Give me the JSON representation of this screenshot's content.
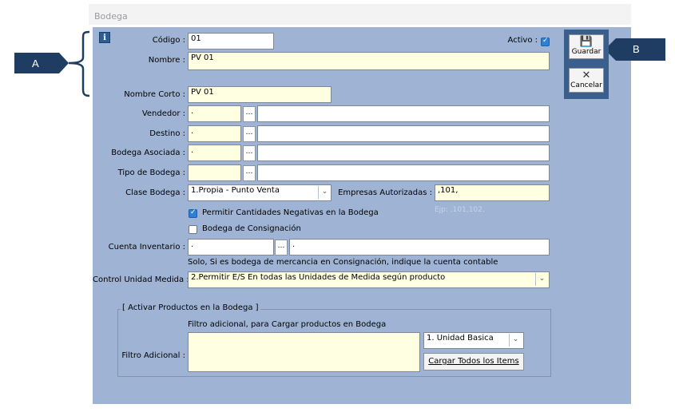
{
  "window": {
    "title": "Bodega"
  },
  "callouts": {
    "a": "A",
    "b": "B"
  },
  "toolbar": {
    "save_label": "Guardar",
    "cancel_label": "Cancelar"
  },
  "form": {
    "codigo": {
      "label": "Código :",
      "value": "01"
    },
    "activo": {
      "label": "Activo :",
      "checked": true
    },
    "nombre": {
      "label": "Nombre :",
      "value": "PV 01"
    },
    "nombre_corto": {
      "label": "Nombre Corto :",
      "value": "PV 01"
    },
    "vendedor": {
      "label": "Vendedor :",
      "code": ".",
      "desc": ""
    },
    "destino": {
      "label": "Destino :",
      "code": ".",
      "desc": ""
    },
    "bodega_asociada": {
      "label": "Bodega Asociada :",
      "code": ".",
      "desc": ""
    },
    "tipo_bodega": {
      "label": "Tipo de Bodega :",
      "code": "",
      "desc": ""
    },
    "clase_bodega": {
      "label": "Clase Bodega :",
      "value": "1.Propia  - Punto Venta"
    },
    "empresas": {
      "label": "Empresas Autorizadas :",
      "value": ",101,",
      "hint": "Ejp: ,101,102,"
    },
    "permitir_negativas": {
      "label": "Permitir Cantidades Negativas en la Bodega",
      "checked": true
    },
    "consignacion": {
      "label": "Bodega de Consignación",
      "checked": false
    },
    "cuenta_inventario": {
      "label": "Cuenta Inventario :",
      "code": ".",
      "desc": ".",
      "note": "Solo, Si es bodega de mercancia en Consignación, indique la cuenta contable"
    },
    "control_unidad": {
      "label": "Control Unidad Medida :",
      "value": "2.Permitir E/S En todas las Unidades de Medida según producto"
    },
    "activar_productos": {
      "legend": "[ Activar Productos en la  Bodega ]",
      "filtro_note": "Filtro adicional, para Cargar  productos en Bodega",
      "filtro_label": "Filtro Adicional :",
      "filtro_value": "",
      "unidad_value": "1. Unidad Basica",
      "cargar_label": "Cargar Todos los Items"
    }
  }
}
